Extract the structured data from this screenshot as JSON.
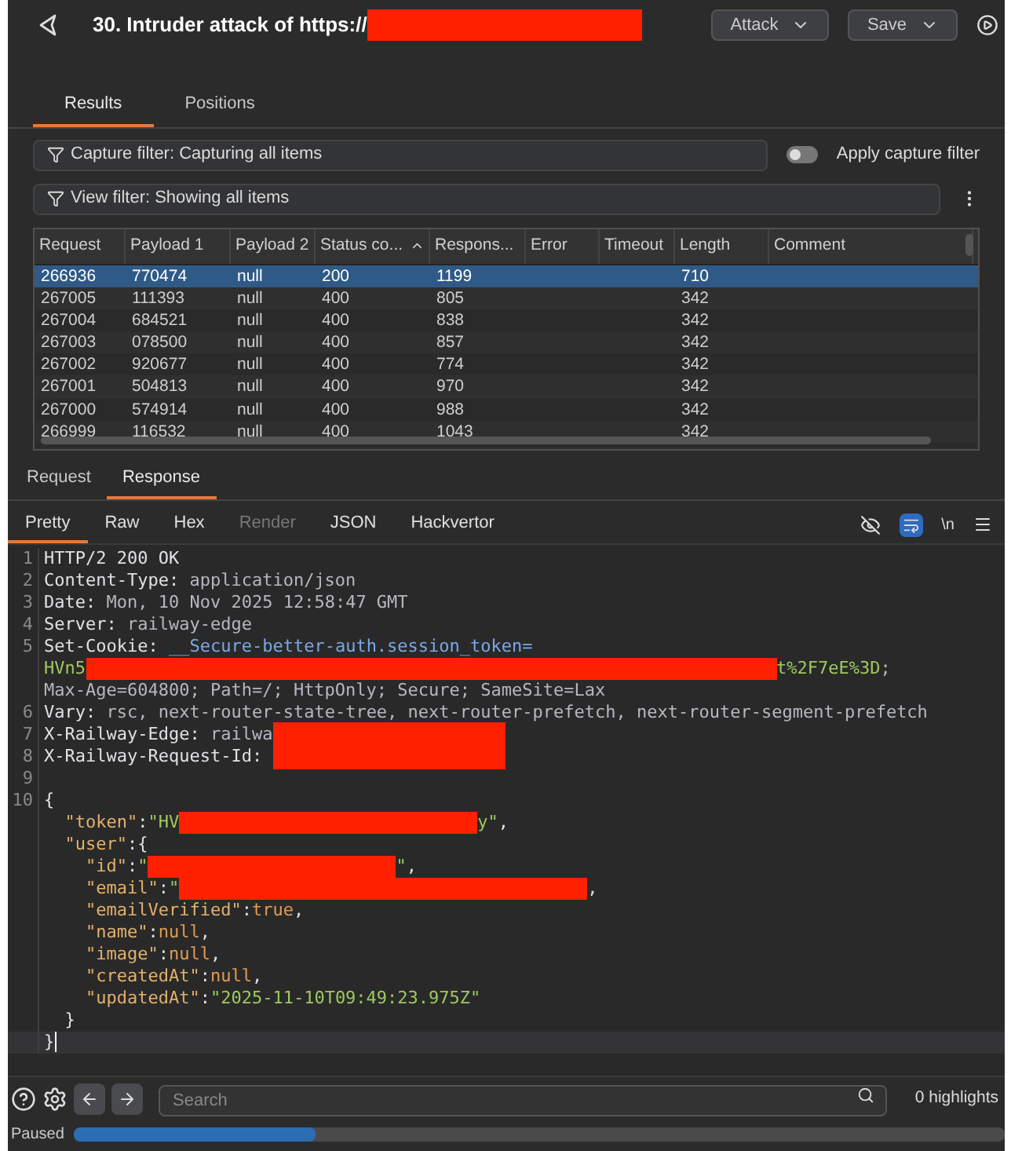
{
  "header": {
    "title": "30. Intruder attack of https://",
    "buttons": [
      "Attack",
      "Save"
    ]
  },
  "tabs": [
    {
      "label": "Results",
      "selected": true
    },
    {
      "label": "Positions",
      "selected": false
    }
  ],
  "capture_filter": {
    "label": "Capture filter: Capturing all items",
    "toggle_label": "Apply capture filter",
    "on": false
  },
  "view_filter": {
    "label": "View filter: Showing all items"
  },
  "table": {
    "columns": [
      "Request",
      "Payload 1",
      "Payload 2",
      "Status co...",
      "Respons...",
      "Error",
      "Timeout",
      "Length",
      "Comment"
    ],
    "rows": [
      {
        "selected": true,
        "cells": [
          "266936",
          "770474",
          "null",
          "200",
          "1199",
          "",
          "",
          "710",
          ""
        ]
      },
      {
        "selected": false,
        "cells": [
          "267005",
          "111393",
          "null",
          "400",
          "805",
          "",
          "",
          "342",
          ""
        ]
      },
      {
        "selected": false,
        "cells": [
          "267004",
          "684521",
          "null",
          "400",
          "838",
          "",
          "",
          "342",
          ""
        ]
      },
      {
        "selected": false,
        "cells": [
          "267003",
          "078500",
          "null",
          "400",
          "857",
          "",
          "",
          "342",
          ""
        ]
      },
      {
        "selected": false,
        "cells": [
          "267002",
          "920677",
          "null",
          "400",
          "774",
          "",
          "",
          "342",
          ""
        ]
      },
      {
        "selected": false,
        "cells": [
          "267001",
          "504813",
          "null",
          "400",
          "970",
          "",
          "",
          "342",
          ""
        ]
      },
      {
        "selected": false,
        "cells": [
          "267000",
          "574914",
          "null",
          "400",
          "988",
          "",
          "",
          "342",
          ""
        ]
      },
      {
        "selected": false,
        "cells": [
          "266999",
          "116532",
          "null",
          "400",
          "1043",
          "",
          "",
          "342",
          ""
        ]
      }
    ]
  },
  "message_tabs": [
    {
      "label": "Request",
      "selected": false
    },
    {
      "label": "Response",
      "selected": true
    }
  ],
  "view_tabs": [
    {
      "label": "Pretty",
      "selected": true,
      "disabled": false
    },
    {
      "label": "Raw",
      "selected": false,
      "disabled": false
    },
    {
      "label": "Hex",
      "selected": false,
      "disabled": false
    },
    {
      "label": "Render",
      "selected": false,
      "disabled": true
    },
    {
      "label": "JSON",
      "selected": false,
      "disabled": false
    },
    {
      "label": "Hackvertor",
      "selected": false,
      "disabled": false
    }
  ],
  "editor_tools": {
    "wrap_on": true,
    "newline_label": "\\n"
  },
  "code_lines": [
    {
      "number": "1",
      "segments": [
        {
          "kind": "key",
          "text": "HTTP/2 200 OK"
        }
      ]
    },
    {
      "number": "2",
      "segments": [
        {
          "kind": "key",
          "text": "Content-Type: "
        },
        {
          "kind": "value",
          "text": "application/json"
        }
      ]
    },
    {
      "number": "3",
      "segments": [
        {
          "kind": "key",
          "text": "Date: "
        },
        {
          "kind": "value",
          "text": "Mon, 10 Nov 2025 12:58:47 GMT"
        }
      ]
    },
    {
      "number": "4",
      "segments": [
        {
          "kind": "key",
          "text": "Server: "
        },
        {
          "kind": "value",
          "text": "railway-edge"
        }
      ]
    },
    {
      "number": "5",
      "segments": [
        {
          "kind": "key",
          "text": "Set-Cookie: "
        },
        {
          "kind": "cookie",
          "text": "__Secure-better-auth.session_token="
        }
      ]
    },
    {
      "segments": [
        {
          "kind": "string",
          "text": "HVn5"
        },
        {
          "kind": "redaction"
        },
        {
          "kind": "string",
          "text": "t%2F7eE%3D"
        },
        {
          "kind": "value",
          "text": ";"
        }
      ]
    },
    {
      "segments": [
        {
          "kind": "value",
          "text": "Max-Age=604800; Path=/; HttpOnly; Secure; SameSite=Lax"
        }
      ]
    },
    {
      "number": "6",
      "segments": [
        {
          "kind": "key",
          "text": "Vary: "
        },
        {
          "kind": "value",
          "text": "rsc, next-router-state-tree, next-router-prefetch, next-router-segment-prefetch"
        }
      ]
    },
    {
      "number": "7",
      "segments": [
        {
          "kind": "key",
          "text": "X-Railway-Edge: "
        },
        {
          "kind": "value",
          "text": "railwa"
        },
        {
          "kind": "redaction"
        }
      ]
    },
    {
      "number": "8",
      "segments": [
        {
          "kind": "key",
          "text": "X-Railway-Request-Id: "
        },
        {
          "kind": "redaction"
        }
      ]
    },
    {
      "number": "9"
    },
    {
      "number": "10",
      "segments": [
        {
          "kind": "key",
          "text": "{"
        }
      ]
    },
    {
      "segments": [
        {
          "kind": "prop",
          "text": "  \"token\""
        },
        {
          "kind": "key",
          "text": ":"
        },
        {
          "kind": "string",
          "text": "\"HV"
        },
        {
          "kind": "redaction"
        },
        {
          "kind": "string",
          "text": "y\""
        },
        {
          "kind": "key",
          "text": ","
        }
      ]
    },
    {
      "segments": [
        {
          "kind": "prop",
          "text": "  \"user\""
        },
        {
          "kind": "key",
          "text": ":{"
        }
      ]
    },
    {
      "segments": [
        {
          "kind": "prop",
          "text": "    \"id\""
        },
        {
          "kind": "key",
          "text": ":"
        },
        {
          "kind": "string",
          "text": "\""
        },
        {
          "kind": "redaction"
        },
        {
          "kind": "string",
          "text": "\""
        },
        {
          "kind": "key",
          "text": ","
        }
      ]
    },
    {
      "segments": [
        {
          "kind": "prop",
          "text": "    \"email\""
        },
        {
          "kind": "key",
          "text": ":"
        },
        {
          "kind": "string",
          "text": "\""
        },
        {
          "kind": "redaction"
        },
        {
          "kind": "key",
          "text": ","
        }
      ]
    },
    {
      "segments": [
        {
          "kind": "prop",
          "text": "    \"emailVerified\""
        },
        {
          "kind": "key",
          "text": ":"
        },
        {
          "kind": "literal",
          "text": "true"
        },
        {
          "kind": "key",
          "text": ","
        }
      ]
    },
    {
      "segments": [
        {
          "kind": "prop",
          "text": "    \"name\""
        },
        {
          "kind": "key",
          "text": ":"
        },
        {
          "kind": "literal",
          "text": "null"
        },
        {
          "kind": "key",
          "text": ","
        }
      ]
    },
    {
      "segments": [
        {
          "kind": "prop",
          "text": "    \"image\""
        },
        {
          "kind": "key",
          "text": ":"
        },
        {
          "kind": "literal",
          "text": "null"
        },
        {
          "kind": "key",
          "text": ","
        }
      ]
    },
    {
      "segments": [
        {
          "kind": "prop",
          "text": "    \"createdAt\""
        },
        {
          "kind": "key",
          "text": ":"
        },
        {
          "kind": "literal",
          "text": "null"
        },
        {
          "kind": "key",
          "text": ","
        }
      ]
    },
    {
      "segments": [
        {
          "kind": "prop",
          "text": "    \"updatedAt\""
        },
        {
          "kind": "key",
          "text": ":"
        },
        {
          "kind": "string",
          "text": "\"2025-11-10T09:49:23.975Z\""
        }
      ]
    },
    {
      "segments": [
        {
          "kind": "key",
          "text": "  }"
        }
      ]
    },
    {
      "current": true,
      "segments": [
        {
          "kind": "key",
          "text": "}"
        }
      ]
    }
  ],
  "search": {
    "placeholder": "Search",
    "highlights": "0 highlights"
  },
  "status": {
    "label": "Paused",
    "level": 0.26
  }
}
